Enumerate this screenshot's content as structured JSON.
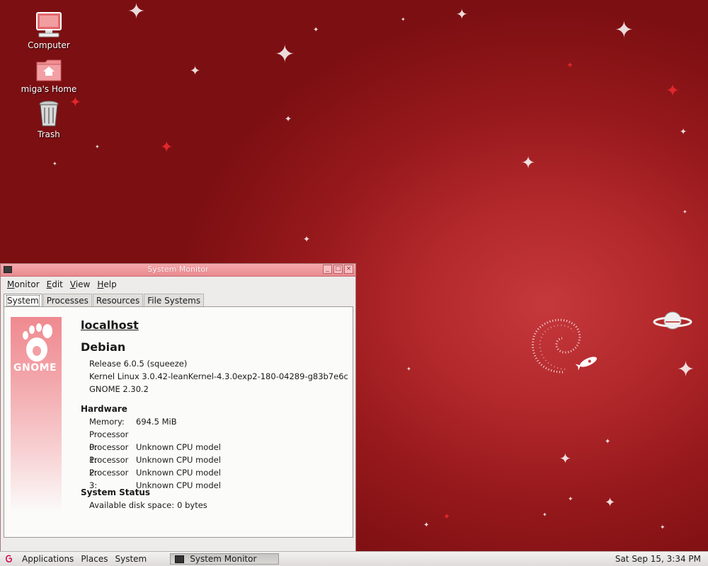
{
  "desktop": {
    "icons": [
      {
        "label": "Computer",
        "icon": "computer-icon"
      },
      {
        "label": "miga's Home",
        "icon": "home-folder-icon"
      },
      {
        "label": "Trash",
        "icon": "trash-icon"
      }
    ],
    "colors": {
      "background": "#b2282b",
      "accent_star": "#e0272c"
    }
  },
  "window": {
    "title": "System Monitor",
    "menu": [
      "Monitor",
      "Edit",
      "View",
      "Help"
    ],
    "tabs": [
      "System",
      "Processes",
      "Resources",
      "File Systems"
    ],
    "active_tab": "System",
    "logo_text": "GNOME",
    "hostname": "localhost",
    "distro": "Debian",
    "release": "Release 6.0.5 (squeeze)",
    "kernel": "Kernel Linux 3.0.42-leanKernel-4.3.0exp2-180-04289-g83b7e6c",
    "gnome": "GNOME 2.30.2",
    "hardware": {
      "heading": "Hardware",
      "memory_label": "Memory:",
      "memory_value": "694.5 MiB",
      "processors": [
        {
          "label": "Processor 0:",
          "value": "Unknown CPU model"
        },
        {
          "label": "Processor 1:",
          "value": "Unknown CPU model"
        },
        {
          "label": "Processor 2:",
          "value": "Unknown CPU model"
        },
        {
          "label": "Processor 3:",
          "value": "Unknown CPU model"
        }
      ]
    },
    "status": {
      "heading": "System Status",
      "disk_label": "Available disk space:",
      "disk_value": "0 bytes"
    }
  },
  "panel": {
    "menus": [
      "Applications",
      "Places",
      "System"
    ],
    "task": "System Monitor",
    "clock": "Sat Sep 15,  3:34 PM"
  }
}
